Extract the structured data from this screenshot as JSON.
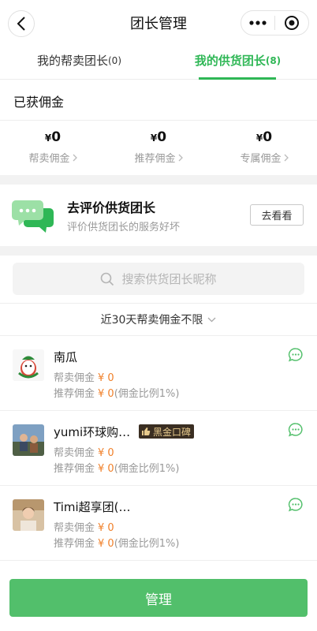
{
  "nav": {
    "title": "团长管理",
    "more_icon": "more-dots-icon",
    "target_icon": "target-icon"
  },
  "tabs": [
    {
      "label": "我的帮卖团长",
      "count": "(0)",
      "active": false
    },
    {
      "label": "我的供货团长",
      "count": "(8)",
      "active": true
    }
  ],
  "earned": {
    "title": "已获佣金",
    "items": [
      {
        "currency": "¥",
        "value": "0",
        "label": "帮卖佣金"
      },
      {
        "currency": "¥",
        "value": "0",
        "label": "推荐佣金"
      },
      {
        "currency": "¥",
        "value": "0",
        "label": "专属佣金"
      }
    ]
  },
  "review": {
    "title": "去评价供货团长",
    "subtitle": "评价供货团长的服务好坏",
    "button": "去看看"
  },
  "search": {
    "placeholder": "搜索供货团长昵称"
  },
  "filter": {
    "label": "近30天帮卖佣金不限"
  },
  "leaders": [
    {
      "name": "南瓜",
      "badge": "",
      "sell_label": "帮卖佣金",
      "sell_amount": "¥ 0",
      "ref_label": "推荐佣金",
      "ref_amount": "¥ 0",
      "ref_ratio": "(佣金比例1%)"
    },
    {
      "name": "yumi环球购…",
      "badge": "黑金口碑",
      "sell_label": "帮卖佣金",
      "sell_amount": "¥ 0",
      "ref_label": "推荐佣金",
      "ref_amount": "¥ 0",
      "ref_ratio": "(佣金比例1%)"
    },
    {
      "name": "Timi超享团(…",
      "badge": "",
      "sell_label": "帮卖佣金",
      "sell_amount": "¥ 0",
      "ref_label": "推荐佣金",
      "ref_amount": "¥ 0",
      "ref_ratio": "(佣金比例1%)"
    }
  ],
  "footer": {
    "manage_label": "管理"
  },
  "colors": {
    "accent": "#2fb756",
    "button": "#52bf6b",
    "amount": "#f0802a",
    "badge_bg": "#3a2e22",
    "badge_text": "#e8cb8d"
  }
}
